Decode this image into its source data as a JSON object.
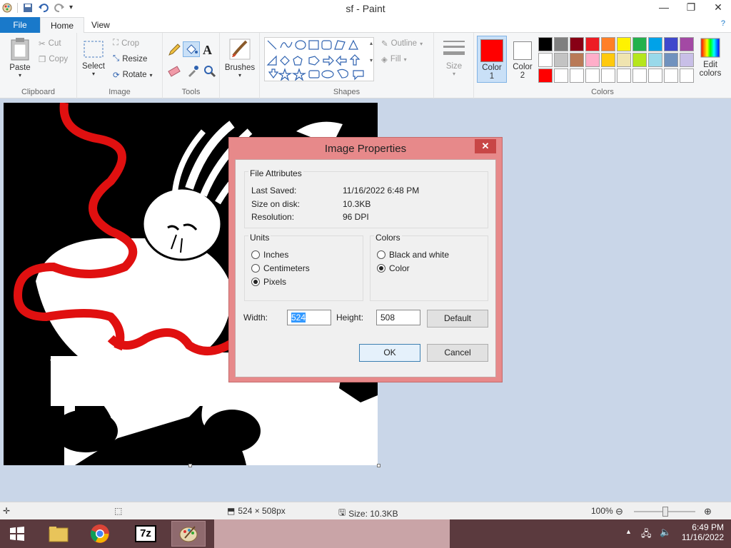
{
  "window": {
    "title": "sf - Paint"
  },
  "tabs": [
    {
      "label": "File"
    },
    {
      "label": "Home"
    },
    {
      "label": "View"
    }
  ],
  "ribbon": {
    "clipboard": {
      "group_label": "Clipboard",
      "paste": "Paste",
      "cut": "Cut",
      "copy": "Copy"
    },
    "image": {
      "group_label": "Image",
      "select": "Select",
      "crop": "Crop",
      "resize": "Resize",
      "rotate": "Rotate"
    },
    "tools": {
      "group_label": "Tools"
    },
    "brushes": {
      "label": "Brushes"
    },
    "shapes": {
      "group_label": "Shapes",
      "outline": "Outline",
      "fill": "Fill"
    },
    "size": {
      "label": "Size"
    },
    "colors": {
      "group_label": "Colors",
      "color1": "Color",
      "color1_num": "1",
      "color2": "Color",
      "color2_num": "2",
      "edit": "Edit",
      "edit2": "colors",
      "color1_value": "#ff0000",
      "color2_value": "#ffffff",
      "palette_row1": [
        "#000000",
        "#7f7f7f",
        "#880015",
        "#ed1c24",
        "#ff7f27",
        "#fff200",
        "#22b14c",
        "#00a2e8",
        "#3f48cc",
        "#a349a4"
      ],
      "palette_row2": [
        "#ffffff",
        "#c3c3c3",
        "#b97a57",
        "#ffaec9",
        "#ffc90e",
        "#efe4b0",
        "#b5e61d",
        "#99d9ea",
        "#7092be",
        "#c8bfe7"
      ],
      "palette_row3": [
        "#ff0000",
        "#ffffff",
        "#ffffff",
        "#ffffff",
        "#ffffff",
        "#ffffff",
        "#ffffff",
        "#ffffff",
        "#ffffff",
        "#ffffff"
      ]
    }
  },
  "dialog": {
    "title": "Image Properties",
    "close": "✕",
    "file_attributes": {
      "legend": "File Attributes",
      "last_saved_label": "Last Saved:",
      "last_saved_value": "11/16/2022 6:48 PM",
      "size_label": "Size on disk:",
      "size_value": "10.3KB",
      "resolution_label": "Resolution:",
      "resolution_value": "96 DPI"
    },
    "units": {
      "legend": "Units",
      "options": [
        "Inches",
        "Centimeters",
        "Pixels"
      ],
      "selected": "Pixels"
    },
    "colors": {
      "legend": "Colors",
      "options": [
        "Black and white",
        "Color"
      ],
      "selected": "Color"
    },
    "width_label": "Width:",
    "width_value": "524",
    "height_label": "Height:",
    "height_value": "508",
    "default_button": "Default",
    "ok_button": "OK",
    "cancel_button": "Cancel"
  },
  "status": {
    "dimensions": "524 × 508px",
    "size": "Size: 10.3KB",
    "zoom": "100%"
  },
  "taskbar": {
    "time": "6:49 PM",
    "date": "11/16/2022"
  }
}
